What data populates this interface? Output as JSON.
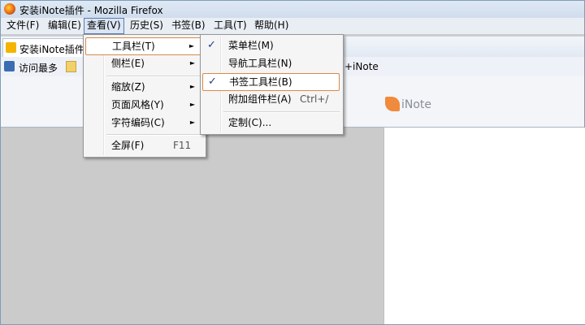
{
  "window": {
    "title": "安装iNote插件 - Mozilla Firefox"
  },
  "menubar": {
    "items": [
      "文件(F)",
      "编辑(E)",
      "查看(V)",
      "历史(S)",
      "书签(B)",
      "工具(T)",
      "帮助(H)"
    ]
  },
  "tabs": [
    {
      "label": "安装iNote插件"
    }
  ],
  "bookmarks": {
    "first": "访问最多",
    "right_fragment": "+iNote"
  },
  "addon": {
    "logo_text": "iNote",
    "accent": "#f08a3c"
  },
  "view_menu": {
    "items": [
      {
        "label": "工具栏(T)",
        "arrow": "►"
      },
      {
        "label": "侧栏(E)",
        "arrow": "►"
      },
      {
        "label": "缩放(Z)",
        "arrow": "►"
      },
      {
        "label": "页面风格(Y)",
        "arrow": "►"
      },
      {
        "label": "字符编码(C)",
        "arrow": "►"
      },
      {
        "label": "全屏(F)",
        "accel": "F11"
      }
    ]
  },
  "toolbars_menu": {
    "items": [
      {
        "label": "菜单栏(M)",
        "check": "✓"
      },
      {
        "label": "导航工具栏(N)",
        "check": ""
      },
      {
        "label": "书签工具栏(B)",
        "check": "✓"
      },
      {
        "label": "附加组件栏(A)",
        "accel": "Ctrl+/"
      },
      {
        "label": "定制(C)..."
      }
    ]
  }
}
